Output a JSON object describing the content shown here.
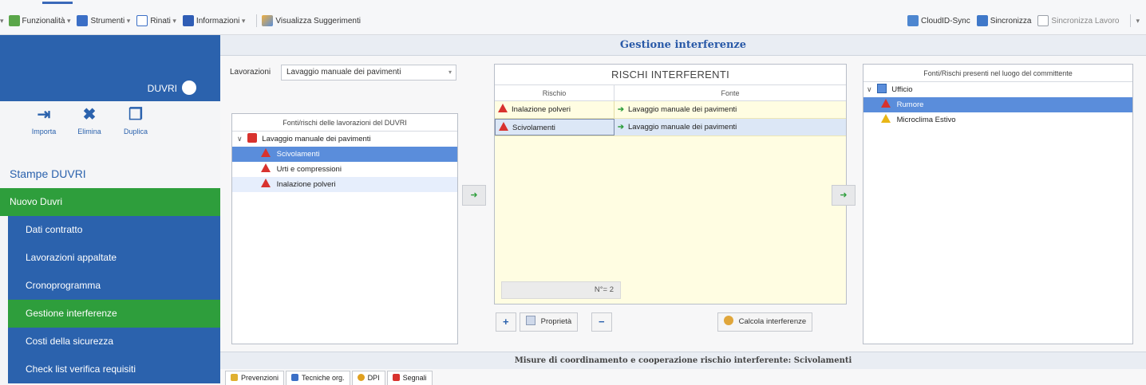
{
  "toolbar": {
    "left_items": [
      {
        "label": "Funzionalità",
        "icon": "functions-icon"
      },
      {
        "label": "Strumenti",
        "icon": "tools-icon"
      },
      {
        "label": "Rinati",
        "icon": "risks-icon"
      },
      {
        "label": "Informazioni",
        "icon": "info-icon"
      },
      {
        "label": "Visualizza Suggerimenti",
        "icon": "suggestions-icon"
      }
    ],
    "right_items": [
      {
        "label": "CloudID-Sync",
        "icon": "cloud-sync-icon"
      },
      {
        "label": "Sincronizza",
        "icon": "sync-icon"
      },
      {
        "label": "Sincronizza Lavoro",
        "icon": "sync-work-icon"
      }
    ]
  },
  "sidebar": {
    "header_label": "DUVRI",
    "actions": [
      {
        "label": "Importa",
        "icon": "import-icon",
        "glyph": "⇥"
      },
      {
        "label": "Elimina",
        "icon": "delete-icon",
        "glyph": "✖"
      },
      {
        "label": "Duplica",
        "icon": "duplicate-icon",
        "glyph": "❐"
      }
    ],
    "section_title": "Stampe DUVRI",
    "menu": [
      {
        "label": "Nuovo Duvri",
        "style": "green"
      },
      {
        "label": "Dati contratto",
        "style": "blue"
      },
      {
        "label": "Lavorazioni appaltate",
        "style": "blue"
      },
      {
        "label": "Cronoprogramma",
        "style": "blue"
      },
      {
        "label": "Gestione interferenze",
        "style": "green"
      },
      {
        "label": "Costi della sicurezza",
        "style": "blue"
      },
      {
        "label": "Check list verifica requisiti",
        "style": "blue"
      }
    ]
  },
  "main": {
    "title": "Gestione interferenze",
    "lavorazioni_label": "Lavorazioni",
    "lavorazioni_value": "Lavaggio manuale dei pavimenti",
    "left_panel": {
      "header": "Fonti/rischi delle lavorazioni del DUVRI",
      "root": "Lavaggio manuale dei pavimenti",
      "items": [
        {
          "label": "Scivolamenti",
          "selected": true
        },
        {
          "label": "Urti e compressioni",
          "selected": false
        },
        {
          "label": "Inalazione polveri",
          "selected": false
        }
      ]
    },
    "rischi": {
      "title": "RISCHI INTERFERENTI",
      "col_rischio": "Rischio",
      "col_fonte": "Fonte",
      "rows": [
        {
          "rischio": "Inalazione polveri",
          "fonte": "Lavaggio manuale dei pavimenti"
        },
        {
          "rischio": "Scivolamenti",
          "fonte": "Lavaggio manuale dei pavimenti"
        }
      ],
      "count": "N°= 2"
    },
    "buttons": {
      "add": "+",
      "properties": "Proprietà",
      "remove": "−",
      "compute": "Calcola interferenze"
    },
    "right_panel": {
      "header": "Fonti/Rischi presenti nel luogo del committente",
      "root": "Ufficio",
      "items": [
        {
          "label": "Rumore",
          "color": "red",
          "selected": true
        },
        {
          "label": "Microclima Estivo",
          "color": "yellow",
          "selected": false
        }
      ]
    },
    "bottom_title": "Misure di coordinamento e cooperazione rischio interferente: Scivolamenti",
    "tabs": [
      "Prevenzioni",
      "Tecniche org.",
      "DPI",
      "Segnali"
    ]
  }
}
